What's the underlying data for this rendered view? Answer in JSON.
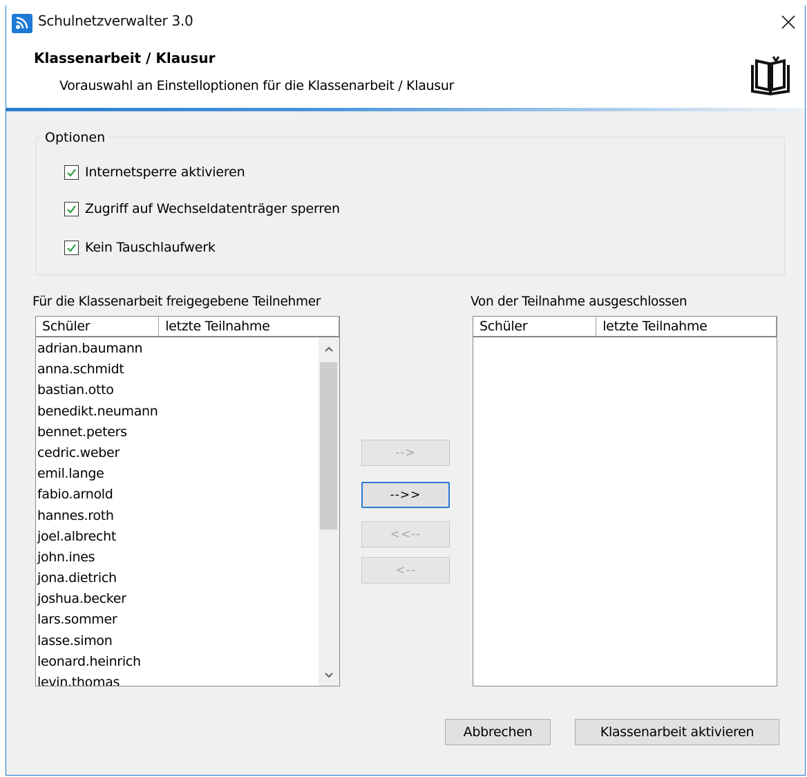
{
  "window": {
    "title": "Schulnetzverwalter 3.0"
  },
  "header": {
    "title": "Klassenarbeit / Klausur",
    "subtitle": "Vorauswahl an Einstelloptionen für die Klassenarbeit / Klausur"
  },
  "options": {
    "legend": "Optionen",
    "items": [
      {
        "label": "Internetsperre aktivieren",
        "checked": true
      },
      {
        "label": "Zugriff auf Wechseldatenträger sperren",
        "checked": true
      },
      {
        "label": "Kein Tauschlaufwerk",
        "checked": true
      }
    ]
  },
  "allowed_list": {
    "label": "Für die Klassenarbeit freigegebene Teilnehmer",
    "columns": [
      "Schüler",
      "letzte Teilnahme"
    ],
    "rows": [
      "adrian.baumann",
      "anna.schmidt",
      "bastian.otto",
      "benedikt.neumann",
      "bennet.peters",
      "cedric.weber",
      "emil.lange",
      "fabio.arnold",
      "hannes.roth",
      "joel.albrecht",
      "john.ines",
      "jona.dietrich",
      "joshua.becker",
      "lars.sommer",
      "lasse.simon",
      "leonard.heinrich",
      "levin.thomas"
    ]
  },
  "excluded_list": {
    "label": "Von der Teilnahme ausgeschlossen",
    "columns": [
      "Schüler",
      "letzte Teilnahme"
    ],
    "rows": []
  },
  "move_buttons": {
    "move_selected": "-->",
    "move_all": "-->>",
    "return_all": "<<--",
    "return_selected": "<--"
  },
  "footer": {
    "cancel": "Abbrechen",
    "activate": "Klassenarbeit aktivieren"
  },
  "colors": {
    "accent": "#1f78d1",
    "check": "#2a9d3c"
  }
}
